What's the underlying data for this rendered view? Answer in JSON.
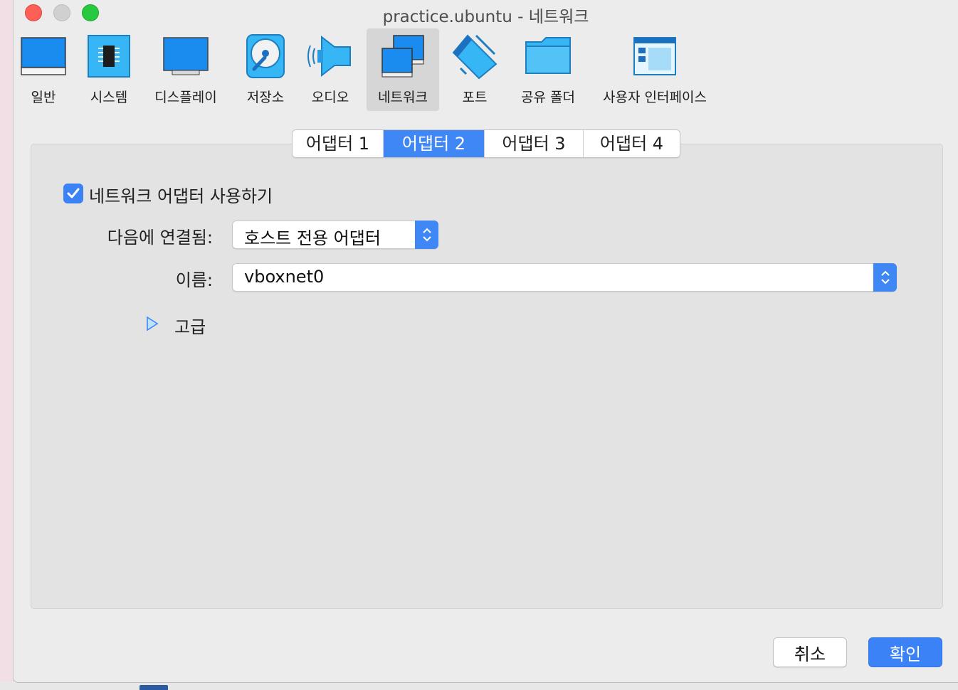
{
  "window": {
    "title": "practice.ubuntu - 네트워크"
  },
  "toolbar": {
    "items": [
      {
        "label": "일반",
        "icon": "monitor-icon"
      },
      {
        "label": "시스템",
        "icon": "chip-icon"
      },
      {
        "label": "디스플레이",
        "icon": "display-icon"
      },
      {
        "label": "저장소",
        "icon": "storage-icon"
      },
      {
        "label": "오디오",
        "icon": "speaker-icon"
      },
      {
        "label": "네트워크",
        "icon": "network-icon"
      },
      {
        "label": "포트",
        "icon": "port-icon"
      },
      {
        "label": "공유 폴더",
        "icon": "folder-icon"
      },
      {
        "label": "사용자 인터페이스",
        "icon": "ui-window-icon"
      }
    ],
    "active": "네트워크"
  },
  "tabs": {
    "items": [
      "어댑터 1",
      "어댑터 2",
      "어댑터 3",
      "어댑터 4"
    ],
    "active": "어댑터 2"
  },
  "adapter": {
    "enable_label": "네트워크 어댑터 사용하기",
    "enabled": true,
    "attached_label": "다음에 연결됨:",
    "attached_value": "호스트 전용 어댑터",
    "name_label": "이름:",
    "name_value": "vboxnet0",
    "advanced_label": "고급"
  },
  "buttons": {
    "cancel": "취소",
    "ok": "확인"
  },
  "colors": {
    "accent": "#3e87f5",
    "close": "#fe5f57",
    "maximize": "#28c840"
  }
}
